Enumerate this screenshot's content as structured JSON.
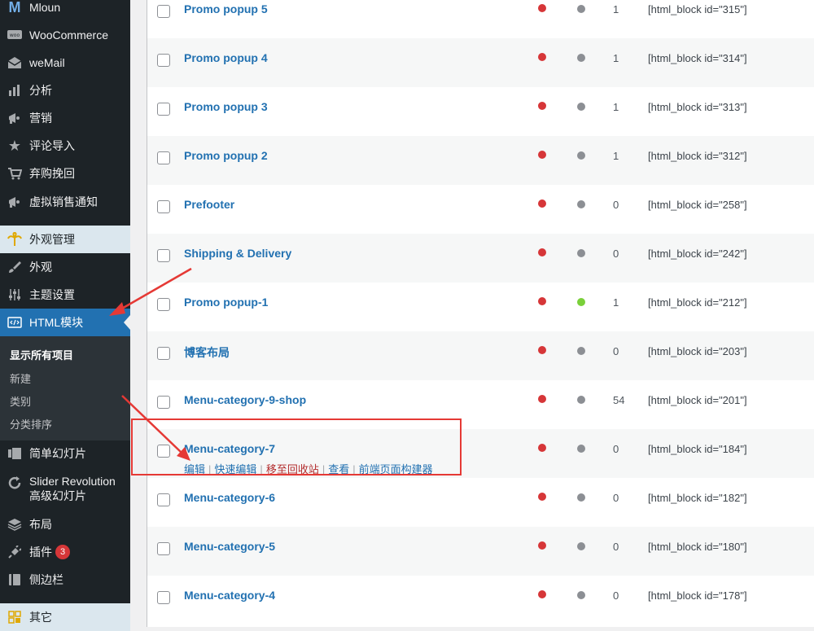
{
  "sidebar": {
    "items": [
      {
        "name": "mloun",
        "label": "Mloun",
        "icon": "m-logo-icon"
      },
      {
        "name": "woocommerce",
        "label": "WooCommerce",
        "icon": "woo-icon"
      },
      {
        "name": "wemail",
        "label": "weMail",
        "icon": "email-icon"
      },
      {
        "name": "analytics",
        "label": "分析",
        "icon": "bar-chart-icon"
      },
      {
        "name": "marketing",
        "label": "营销",
        "icon": "megaphone-icon"
      },
      {
        "name": "review-import",
        "label": "评论导入",
        "icon": "star-icon"
      },
      {
        "name": "cart-recovery",
        "label": "弃购挽回",
        "icon": "cart-icon"
      },
      {
        "name": "virtual-sales",
        "label": "虚拟销售通知",
        "icon": "megaphone-icon"
      },
      {
        "name": "appearance-manage",
        "label": "外观管理",
        "icon": "palm-icon"
      },
      {
        "name": "appearance",
        "label": "外观",
        "icon": "brush-icon"
      },
      {
        "name": "theme-settings",
        "label": "主题设置",
        "icon": "sliders-icon"
      },
      {
        "name": "html-blocks",
        "label": "HTML模块",
        "icon": "code-icon"
      },
      {
        "name": "simple-slider",
        "label": "简单幻灯片",
        "icon": "slides-icon"
      },
      {
        "name": "slider-revolution",
        "label": "Slider Revolution",
        "label2": "高级幻灯片",
        "icon": "refresh-icon"
      },
      {
        "name": "layout",
        "label": "布局",
        "icon": "layers-icon"
      },
      {
        "name": "plugins",
        "label": "插件",
        "icon": "plug-icon",
        "badge": "3"
      },
      {
        "name": "sidebar-widgets",
        "label": "侧边栏",
        "icon": "book-icon"
      },
      {
        "name": "other",
        "label": "其它",
        "icon": "grid-icon"
      }
    ],
    "submenu": [
      {
        "label": "显示所有项目"
      },
      {
        "label": "新建"
      },
      {
        "label": "类别"
      },
      {
        "label": "分类排序"
      }
    ]
  },
  "table": {
    "rows": [
      {
        "title": "Promo popup 5",
        "status": "red",
        "status2": "grey",
        "count": "1",
        "shortcode": "[html_block id=\"315\"]"
      },
      {
        "title": "Promo popup 4",
        "status": "red",
        "status2": "grey",
        "count": "1",
        "shortcode": "[html_block id=\"314\"]"
      },
      {
        "title": "Promo popup 3",
        "status": "red",
        "status2": "grey",
        "count": "1",
        "shortcode": "[html_block id=\"313\"]"
      },
      {
        "title": "Promo popup 2",
        "status": "red",
        "status2": "grey",
        "count": "1",
        "shortcode": "[html_block id=\"312\"]"
      },
      {
        "title": "Prefooter",
        "status": "red",
        "status2": "grey",
        "count": "0",
        "shortcode": "[html_block id=\"258\"]"
      },
      {
        "title": "Shipping & Delivery",
        "status": "red",
        "status2": "grey",
        "count": "0",
        "shortcode": "[html_block id=\"242\"]"
      },
      {
        "title": "Promo popup-1",
        "status": "red",
        "status2": "green",
        "count": "1",
        "shortcode": "[html_block id=\"212\"]"
      },
      {
        "title": "博客布局",
        "status": "red",
        "status2": "grey",
        "count": "0",
        "shortcode": "[html_block id=\"203\"]"
      },
      {
        "title": "Menu-category-9-shop",
        "status": "red",
        "status2": "grey",
        "count": "54",
        "shortcode": "[html_block id=\"201\"]"
      },
      {
        "title": "Menu-category-7",
        "status": "red",
        "status2": "grey",
        "count": "0",
        "shortcode": "[html_block id=\"184\"]"
      },
      {
        "title": "Menu-category-6",
        "status": "red",
        "status2": "grey",
        "count": "0",
        "shortcode": "[html_block id=\"182\"]"
      },
      {
        "title": "Menu-category-5",
        "status": "red",
        "status2": "grey",
        "count": "0",
        "shortcode": "[html_block id=\"180\"]"
      },
      {
        "title": "Menu-category-4",
        "status": "red",
        "status2": "grey",
        "count": "0",
        "shortcode": "[html_block id=\"178\"]"
      }
    ],
    "row_actions": {
      "edit": "编辑",
      "quick_edit": "快速编辑",
      "trash": "移至回收站",
      "view": "查看",
      "builder": "前端页面构建器"
    }
  },
  "colors": {
    "accent": "#2271b1",
    "sidebar_bg": "#1d2327",
    "status_red": "#d63638",
    "status_grey": "#8c8f94",
    "status_green": "#7ad03a",
    "annotation": "#e53935"
  }
}
